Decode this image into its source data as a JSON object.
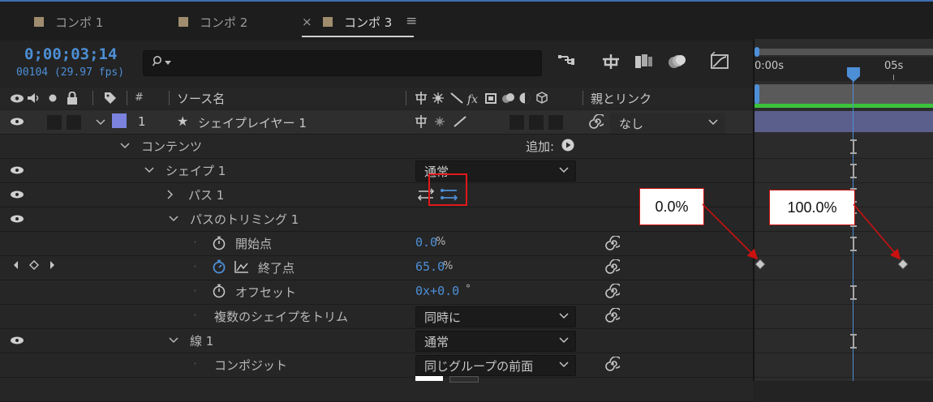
{
  "tabs": [
    {
      "label": "コンポ 1",
      "active": false
    },
    {
      "label": "コンポ 2",
      "active": false
    },
    {
      "label": "コンポ 3",
      "active": true
    }
  ],
  "tab_close": "×",
  "tab_menu": "≡",
  "timecode": "0;00;03;14",
  "frame_info": "00104 (29.97 fps)",
  "search": {
    "value": "",
    "placeholder": ""
  },
  "columns": {
    "number": "#",
    "source_name": "ソース名",
    "parent_link": "親とリンク"
  },
  "layer": {
    "index": "1",
    "star": "★",
    "name": "シェイプレイヤー 1",
    "parent_value": "なし",
    "label_color": "#7b83de"
  },
  "rows": {
    "contents": "コンテンツ",
    "add_label": "追加:",
    "shape1": "シェイプ 1",
    "shape1_mode": "通常",
    "path1": "パス 1",
    "trim": "パスのトリミング 1",
    "start_label": "開始点",
    "start_value": "0.0",
    "end_label": "終了点",
    "end_value": "65.0",
    "offset_label": "オフセット",
    "offset_value": "0x+0.0",
    "trim_multi_label": "複数のシェイプをトリム",
    "trim_multi_value": "同時に",
    "stroke1": "線 1",
    "stroke1_mode": "通常",
    "composite_label": "コンポジット",
    "composite_value": "同じグループの前面"
  },
  "units": {
    "percent": "%",
    "degree": "°"
  },
  "timeline": {
    "ruler_start": "0:00s",
    "ruler_05": "05s"
  },
  "callouts": {
    "start": "0.0%",
    "end": "100.0%"
  },
  "colors": {
    "accent_blue": "#4d8fd6",
    "callout_red": "#cc1010",
    "work_area_green": "#3cc23c"
  }
}
